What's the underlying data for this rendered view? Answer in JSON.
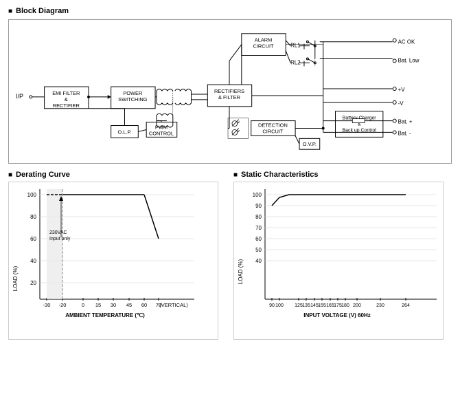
{
  "blockDiagram": {
    "title": "Block Diagram",
    "nodes": {
      "emiFilter": "EMI FILTER\n& \nRECTIFIER",
      "powerSwitching": "POWER\nSWITCHING",
      "rectifiersFilter": "RECTIFIERS\n& FILTER",
      "alarmCircuit": "ALARM\nCIRCUIT",
      "detectionCircuit": "DETECTION\nCIRCUIT",
      "ovp": "O.V.P.",
      "olp": "O.L.P.",
      "pwmControl": "PWM\nCONTROL",
      "batteryCharger": "Battery Charger\n&\nBack up Control",
      "rl1": "RL1",
      "rl2": "RL2",
      "ip": "I/P",
      "acok": "AC OK",
      "batLow": "Bat. Low",
      "plusV": "+V",
      "minusV": "-V",
      "batPlus": "Bat. +",
      "batMinus": "Bat. -"
    }
  },
  "deratingCurve": {
    "title": "Derating Curve",
    "xLabel": "AMBIENT TEMPERATURE (℃)",
    "yLabel": "LOAD (%)",
    "xAxisLabels": [
      "-30",
      "-20",
      "0",
      "15",
      "30",
      "45",
      "60",
      "70"
    ],
    "yAxisLabels": [
      "100",
      "80",
      "60",
      "40",
      "20"
    ],
    "annotation": "230VAC\nInput only",
    "vertical": "(VERTICAL)"
  },
  "staticCharacteristics": {
    "title": "Static Characteristics",
    "xLabel": "INPUT VOLTAGE (V) 60Hz",
    "yLabel": "LOAD (%)",
    "xAxisLabels": [
      "90",
      "100",
      "125",
      "135",
      "145",
      "155",
      "165",
      "175",
      "180",
      "200",
      "230",
      "264"
    ],
    "yAxisLabels": [
      "100",
      "90",
      "80",
      "70",
      "60",
      "50",
      "40"
    ]
  }
}
